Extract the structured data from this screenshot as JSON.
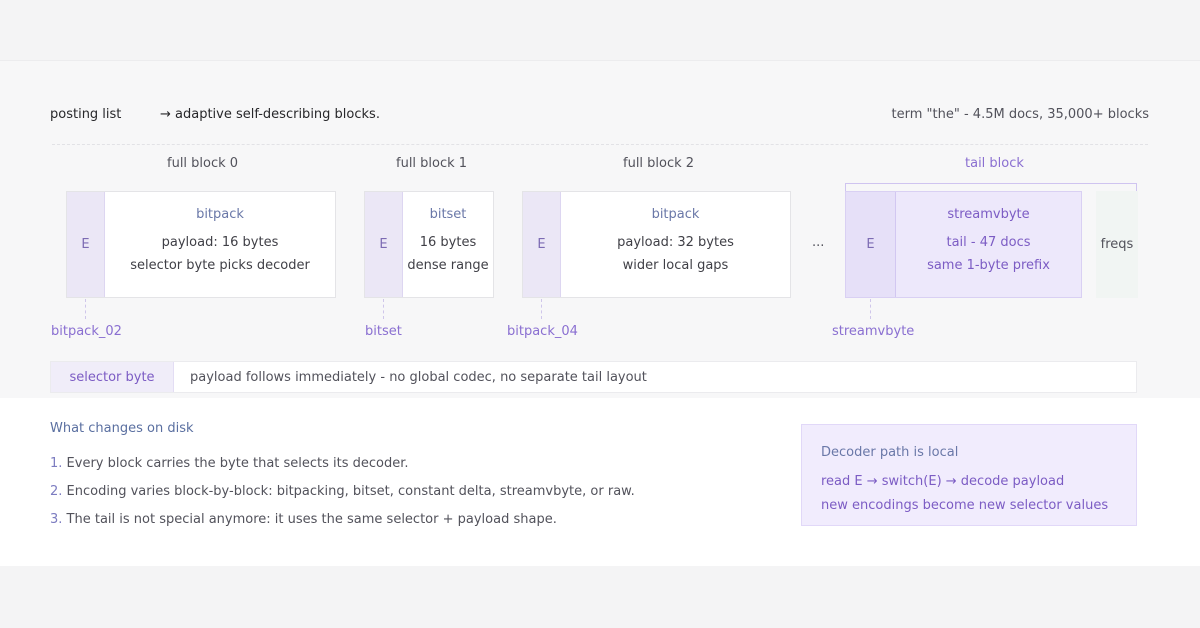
{
  "header": {
    "title": "posting list",
    "subtitle": "→ adaptive self-describing blocks.",
    "meta": "term \"the\" - 4.5M docs, 35,000+ blocks"
  },
  "blocks": [
    {
      "label": "full block 0",
      "selector": "E",
      "encoding": "bitpack",
      "line1": "payload: 16 bytes",
      "line2": "selector byte picks decoder",
      "tag": "bitpack_02"
    },
    {
      "label": "full block 1",
      "selector": "E",
      "encoding": "bitset",
      "line1": "16 bytes",
      "line2": "dense range",
      "tag": "bitset"
    },
    {
      "label": "full block 2",
      "selector": "E",
      "encoding": "bitpack",
      "line1": "payload: 32 bytes",
      "line2": "wider local gaps",
      "tag": "bitpack_04"
    },
    {
      "label": "tail block",
      "selector": "E",
      "encoding": "streamvbyte",
      "line1": "tail - 47 docs",
      "line2": "same 1-byte prefix",
      "tag": "streamvbyte"
    }
  ],
  "ellipsis": "...",
  "freqs": "freqs",
  "selector_row": {
    "label": "selector byte",
    "text": "payload follows immediately - no global codec, no separate tail layout"
  },
  "changes": {
    "heading": "What changes on disk",
    "items": [
      {
        "num": "1.",
        "text": "Every block carries the byte that selects its decoder."
      },
      {
        "num": "2.",
        "text": "Encoding varies block-by-block: bitpacking, bitset, constant delta, streamvbyte, or raw."
      },
      {
        "num": "3.",
        "text": "The tail is not special anymore: it uses the same selector + payload shape."
      }
    ]
  },
  "decoder": {
    "title": "Decoder path is local",
    "line1": "read E → switch(E) → decode payload",
    "line2": "new encodings become new selector values"
  },
  "colors": {
    "accent": "#7c5cc4",
    "selector_fill": "#ebe7f6",
    "tail_fill": "#ede8fb"
  }
}
